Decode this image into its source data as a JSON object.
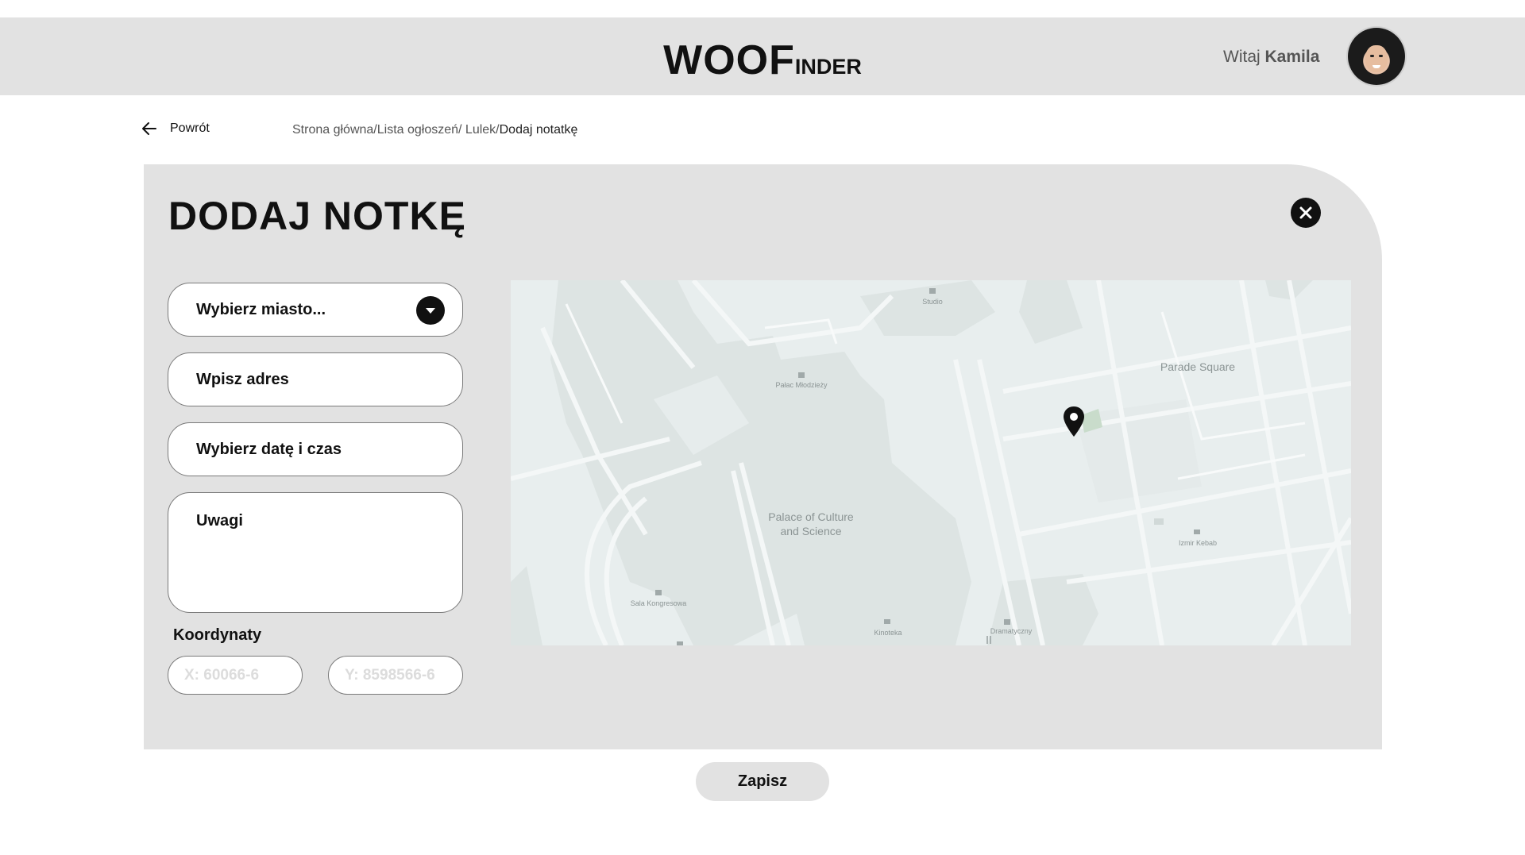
{
  "header": {
    "logo_big": "WOOF",
    "logo_small": "INDER",
    "greeting": "Witaj",
    "user_name": "Kamila"
  },
  "nav": {
    "back_label": "Powrót",
    "breadcrumb_path": "Strona główna/Lista ogłoszeń/ Lulek/",
    "breadcrumb_current": "Dodaj notatkę"
  },
  "form": {
    "title": "DODAJ NOTKĘ",
    "city_placeholder": "Wybierz miasto...",
    "address_placeholder": "Wpisz adres",
    "date_placeholder": "Wybierz datę i czas",
    "notes_placeholder": "Uwagi",
    "coords_label": "Koordynaty",
    "coord_x_placeholder": "X: 60066-6",
    "coord_y_placeholder": "Y: 8598566-6",
    "save_label": "Zapisz"
  },
  "map": {
    "labels": {
      "studio": "Studio",
      "palac_mlodziezy": "Pałac Młodzieży",
      "parade_square": "Parade Square",
      "palace_line1": "Palace of Culture",
      "palace_line2": "and Science",
      "sala_kongresowa": "Sala Kongresowa",
      "kinoteka": "Kinoteka",
      "dramatyczny": "Dramatyczny",
      "izmir_kebab": "Izmir Kebab"
    },
    "colors": {
      "background": "#e8eeee",
      "building": "#dde4e3",
      "street": "#f4f7f7",
      "park": "#c9dccb",
      "pin": "#111111"
    }
  },
  "icons": {
    "back": "arrow-left-icon",
    "close": "close-icon",
    "dropdown": "chevron-down-icon",
    "pin": "map-pin-icon"
  }
}
